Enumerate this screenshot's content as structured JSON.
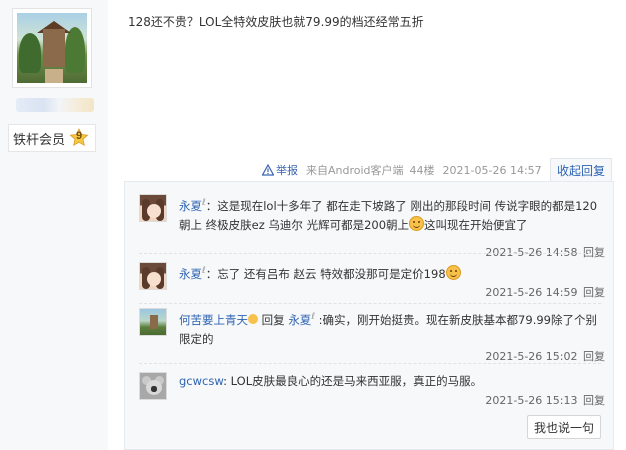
{
  "author": {
    "member_label": "铁杆会员",
    "level": "9"
  },
  "post": {
    "content": "128还不贵？LOL全特效皮肤也就79.99的档还经常五折",
    "report_label": "举报",
    "source": "来自Android客户端",
    "floor": "44楼",
    "time": "2021-05-26 14:57",
    "collapse_label": "收起回复"
  },
  "replies": [
    {
      "user": "永夏",
      "text_a": "：这是现在lol十多年了 都在走下坡路了 刚出的那段时间 传说字眼的都是120朝上 终极皮肤ez 乌迪尔 光辉可都是200朝上",
      "text_b": "这叫现在开始便宜了",
      "time": "2021-5-26 14:58",
      "reply_label": "回复"
    },
    {
      "user": "永夏",
      "text_a": "：忘了 还有吕布 赵云 特效都没那可是定价198",
      "time": "2021-5-26 14:59",
      "reply_label": "回复"
    },
    {
      "user": "何苦要上青天",
      "reply_word": "回复",
      "target": "永夏",
      "text_a": " :确实，刚开始挺贵。现在新皮肤基本都79.99除了个别限定的",
      "time": "2021-5-26 15:02",
      "reply_label": "回复"
    },
    {
      "user": "gcwcsw",
      "text_a": ": LOL皮肤最良心的还是马来西亚服，真正的马服。",
      "time": "2021-5-26 15:13",
      "reply_label": "回复"
    }
  ],
  "say_button": "我也说一句",
  "colors": {
    "link": "#2d64b3",
    "panel_bg": "#f7f8fa",
    "meta": "#999999"
  }
}
